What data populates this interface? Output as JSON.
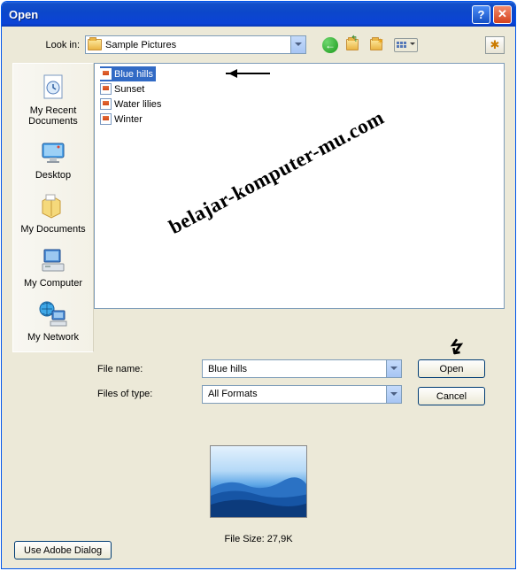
{
  "title": "Open",
  "lookin": {
    "label": "Look in:",
    "value": "Sample Pictures"
  },
  "places": [
    {
      "id": "recent",
      "label": "My Recent Documents"
    },
    {
      "id": "desktop",
      "label": "Desktop"
    },
    {
      "id": "mydocs",
      "label": "My Documents"
    },
    {
      "id": "mycomputer",
      "label": "My Computer"
    },
    {
      "id": "network",
      "label": "My Network"
    }
  ],
  "files": [
    {
      "name": "Blue hills",
      "selected": true
    },
    {
      "name": "Sunset",
      "selected": false
    },
    {
      "name": "Water lilies",
      "selected": false
    },
    {
      "name": "Winter",
      "selected": false
    }
  ],
  "watermark": "belajar-komputer-mu.com",
  "filename": {
    "label": "File name:",
    "value": "Blue hills"
  },
  "filetype": {
    "label": "Files of type:",
    "value": "All Formats"
  },
  "buttons": {
    "open": "Open",
    "cancel": "Cancel",
    "adobe": "Use Adobe Dialog"
  },
  "filesize": {
    "label": "File Size:",
    "value": "27,9K"
  }
}
